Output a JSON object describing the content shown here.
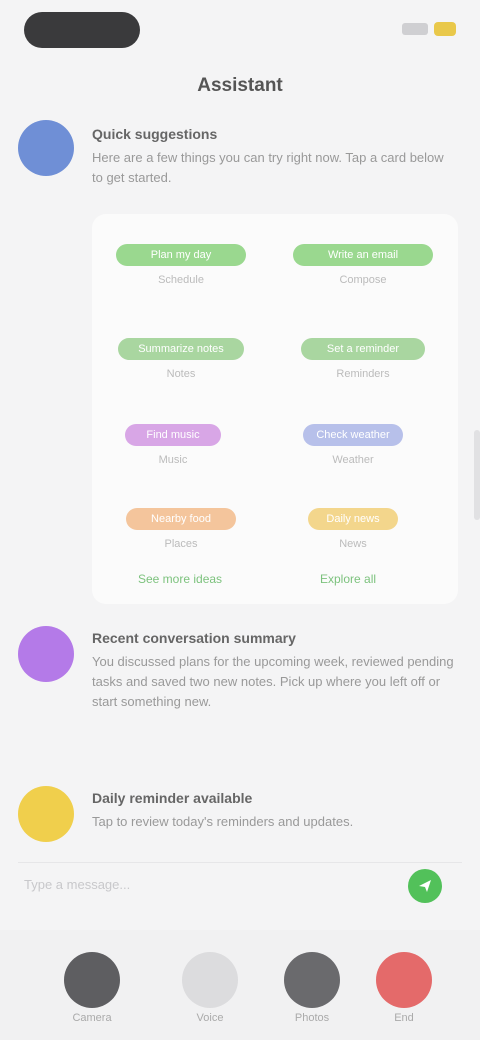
{
  "header": {
    "title": "Assistant"
  },
  "messages": [
    {
      "title": "Quick suggestions",
      "desc": "Here are a few things you can try right now. Tap a card below to get started.",
      "avatar_color": "#6f8fd6"
    },
    {
      "title": "Recent conversation summary",
      "desc": "You discussed plans for the upcoming week, reviewed pending tasks and saved two new notes. Pick up where you left off or start something new.",
      "avatar_color": "#b47ae8"
    },
    {
      "title": "Daily reminder available",
      "desc": "Tap to review today's reminders and updates.",
      "avatar_color": "#f0cf4c"
    }
  ],
  "suggestions": [
    {
      "label": "Plan my day",
      "sub": "Schedule",
      "color": "#9ad88f"
    },
    {
      "label": "Write an email",
      "sub": "Compose",
      "color": "#9ad88f"
    },
    {
      "label": "Summarize notes",
      "sub": "Notes",
      "color": "#a9d6a0"
    },
    {
      "label": "Set a reminder",
      "sub": "Reminders",
      "color": "#a9d6a0"
    },
    {
      "label": "Find music",
      "sub": "Music",
      "color": "#d8a6e6"
    },
    {
      "label": "Check weather",
      "sub": "Weather",
      "color": "#b7c0ea"
    },
    {
      "label": "Nearby food",
      "sub": "Places",
      "color": "#f4c59c"
    },
    {
      "label": "Daily news",
      "sub": "News",
      "color": "#f3d68c"
    }
  ],
  "links": {
    "left": "See more ideas",
    "right": "Explore all"
  },
  "input": {
    "placeholder": "Type a message..."
  },
  "bottom_bar": {
    "items": [
      {
        "label": "Camera",
        "color": "#5e5e61"
      },
      {
        "label": "Voice",
        "color": "#dcdcde"
      },
      {
        "label": "Photos",
        "color": "#6a6a6d"
      },
      {
        "label": "End",
        "color": "#e46a6a"
      }
    ]
  }
}
